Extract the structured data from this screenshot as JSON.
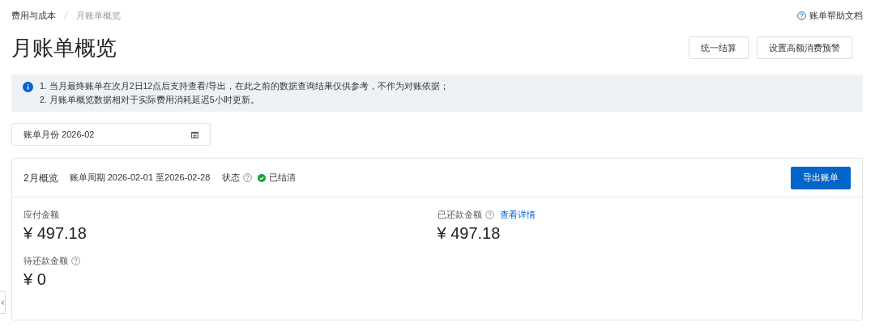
{
  "breadcrumb": [
    {
      "label": "费用与成本",
      "current": false
    },
    {
      "label": "月账单概览",
      "current": true
    }
  ],
  "help_link": "账单帮助文档",
  "title": "月账单概览",
  "actions": [
    "统一结算",
    "设置高额消费预警"
  ],
  "notice": [
    "1. 当月最终账单在次月2日12点后支持查看/导出，在此之前的数据查询结果仅供参考，不作为对账依据；",
    "2. 月账单概览数据相对于实际费用消耗延迟5小时更新。"
  ],
  "month_field": {
    "label": "账单月份",
    "value": "2026-02"
  },
  "overview": {
    "title": "2月概览",
    "period_label": "账单周期",
    "period": "2026-02-01 至2026-02-28",
    "status_label": "状态",
    "status": "已结清",
    "export_button": "导出账单",
    "metrics": [
      {
        "label": "应付金额",
        "help": false,
        "value": "¥ 497.18"
      },
      {
        "label": "已还款金额",
        "help": true,
        "link": "查看详情",
        "value": "¥ 497.18"
      },
      {
        "label": "待还款金额",
        "help": true,
        "value": "¥ 0"
      }
    ]
  }
}
